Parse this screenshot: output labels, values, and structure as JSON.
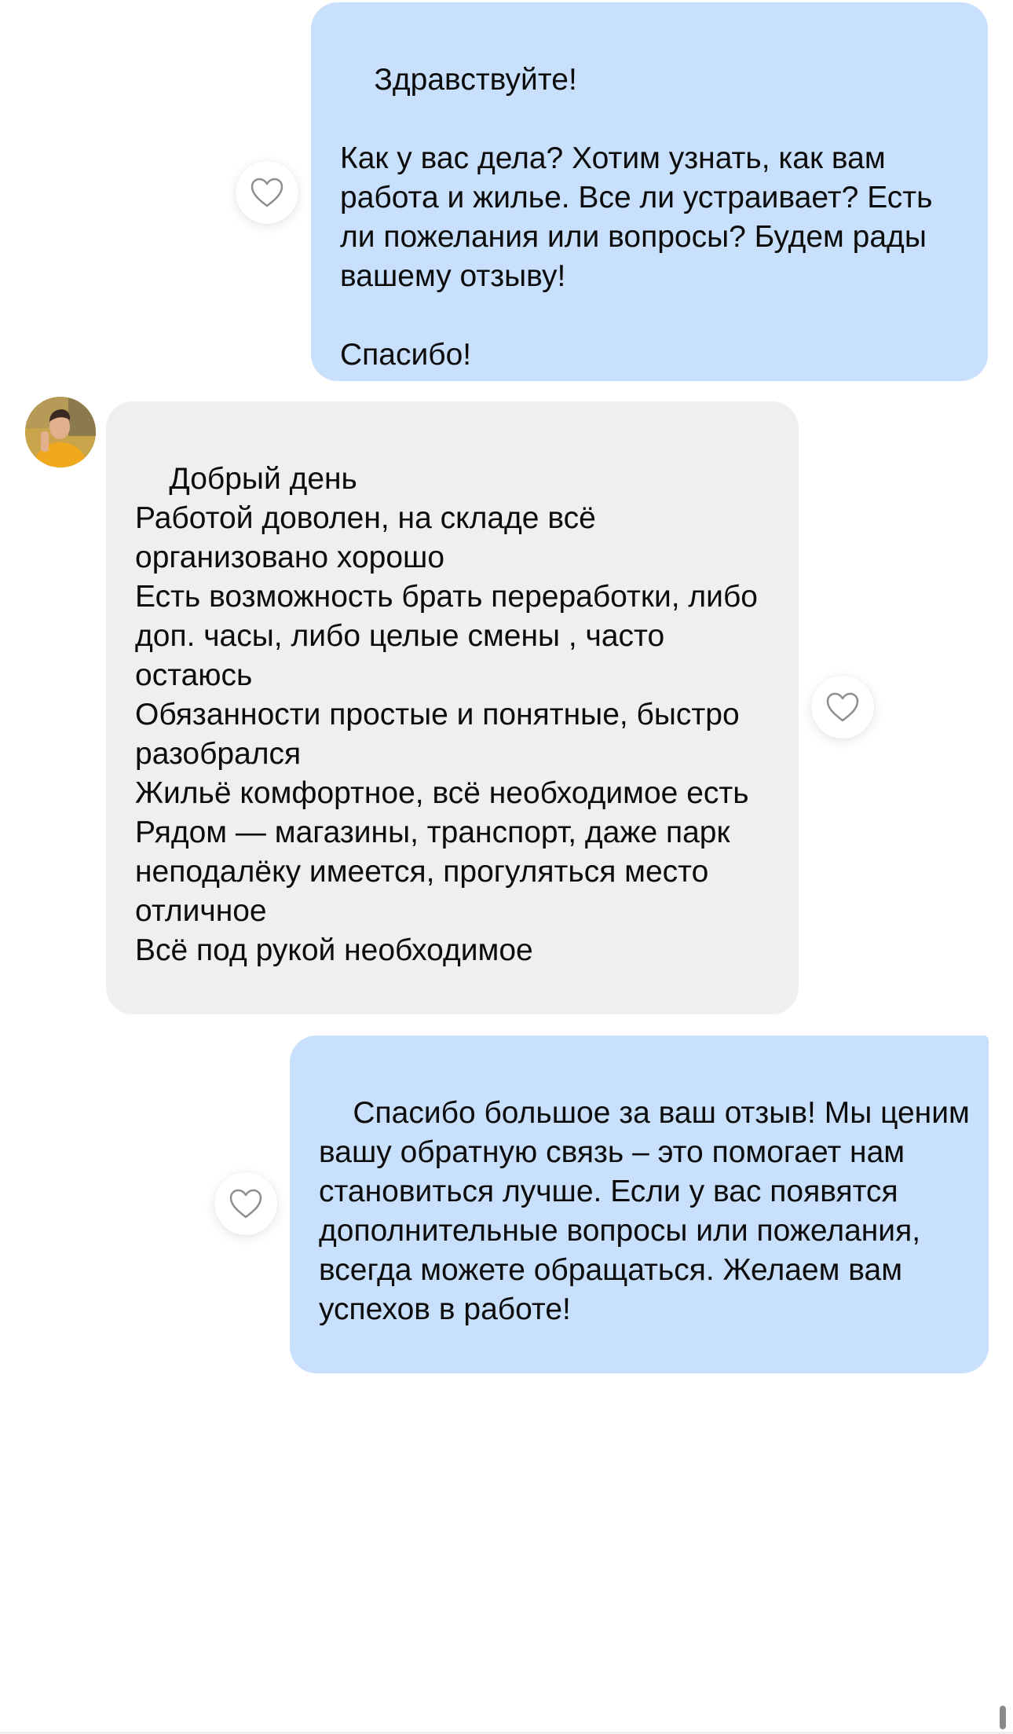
{
  "chat": {
    "messages": [
      {
        "direction": "outgoing",
        "text": "Здравствуйте!\n\nКак у вас дела? Хотим узнать, как вам работа и жилье. Все ли устраивает? Есть ли пожелания или вопросы? Будем рады вашему отзыву!\n\nСпасибо!"
      },
      {
        "direction": "incoming",
        "text": "Добрый день\nРаботой доволен, на складе всё организовано хорошо\nЕсть возможность брать переработки, либо доп. часы, либо целые смены , часто остаюсь\nОбязанности простые и понятные, быстро разобрался\nЖильё комфортное, всё необходимое есть\nРядом — магазины, транспорт, даже парк неподалёку имеется, прогуляться место отличное\nВсё под рукой необходимое"
      },
      {
        "direction": "outgoing",
        "text": "Спасибо большое за ваш отзыв! Мы ценим вашу обратную связь – это помогает нам становиться лучше. Если у вас появятся дополнительные вопросы или пожелания, всегда можете обращаться. Желаем вам успехов в работе!"
      }
    ],
    "icons": {
      "like": "heart-outline-icon",
      "avatar": "user-avatar"
    },
    "colors": {
      "outgoing_bubble": "#c8e0fb",
      "incoming_bubble": "#efefef",
      "background": "#ffffff",
      "heart_stroke": "#8e8e8e"
    }
  }
}
